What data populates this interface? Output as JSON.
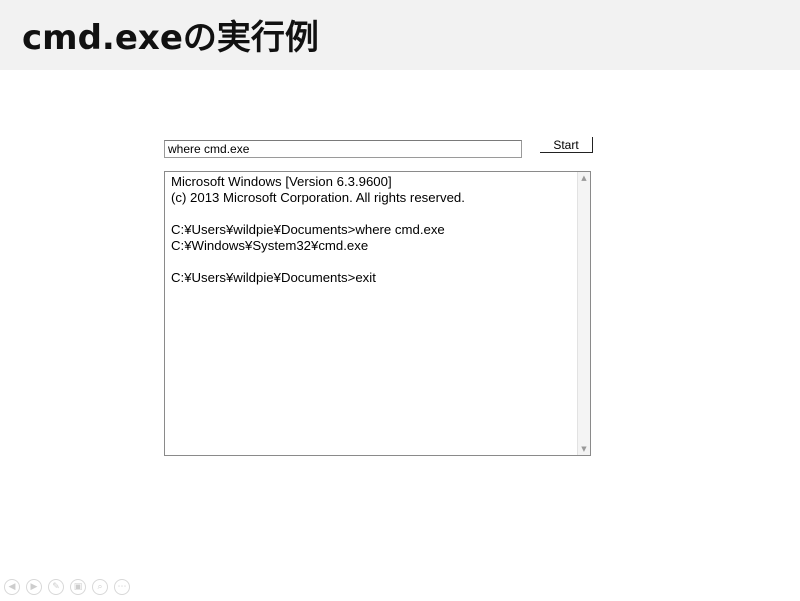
{
  "slide": {
    "title": "cmd.exeの実行例"
  },
  "form": {
    "command_value": "where cmd.exe",
    "start_label": "Start"
  },
  "output": {
    "text": "Microsoft Windows [Version 6.3.9600]\n(c) 2013 Microsoft Corporation. All rights reserved.\n\nC:¥Users¥wildpie¥Documents>where cmd.exe\nC:¥Windows¥System32¥cmd.exe\n\nC:¥Users¥wildpie¥Documents>exit"
  },
  "icons": {
    "scroll_up": "scroll-up-arrow-icon",
    "scroll_down": "scroll-down-arrow-icon",
    "nav": [
      "previous-slide-icon",
      "next-slide-icon",
      "pen-icon",
      "slides-overview-icon",
      "zoom-icon",
      "more-options-icon"
    ]
  },
  "colors": {
    "title_bar": "#f2f2f2",
    "text": "#000000"
  }
}
